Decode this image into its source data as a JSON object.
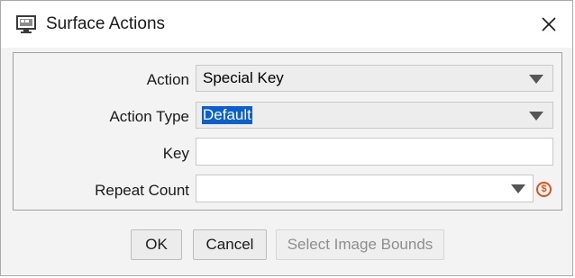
{
  "window": {
    "title": "Surface Actions",
    "icon": "surface-monitor-icon",
    "close_icon": "close-icon"
  },
  "form": {
    "action": {
      "label": "Action",
      "value": "Special Key"
    },
    "action_type": {
      "label": "Action Type",
      "value": "Default",
      "selected": true
    },
    "key": {
      "label": "Key",
      "value": ""
    },
    "repeat_count": {
      "label": "Repeat Count",
      "value": "",
      "variable_icon": "variable-icon",
      "variable_glyph": "$"
    }
  },
  "buttons": {
    "ok": "OK",
    "cancel": "Cancel",
    "select_image_bounds": "Select Image Bounds"
  },
  "colors": {
    "selection": "#0b60d0",
    "variable_icon": "#d9571c"
  }
}
